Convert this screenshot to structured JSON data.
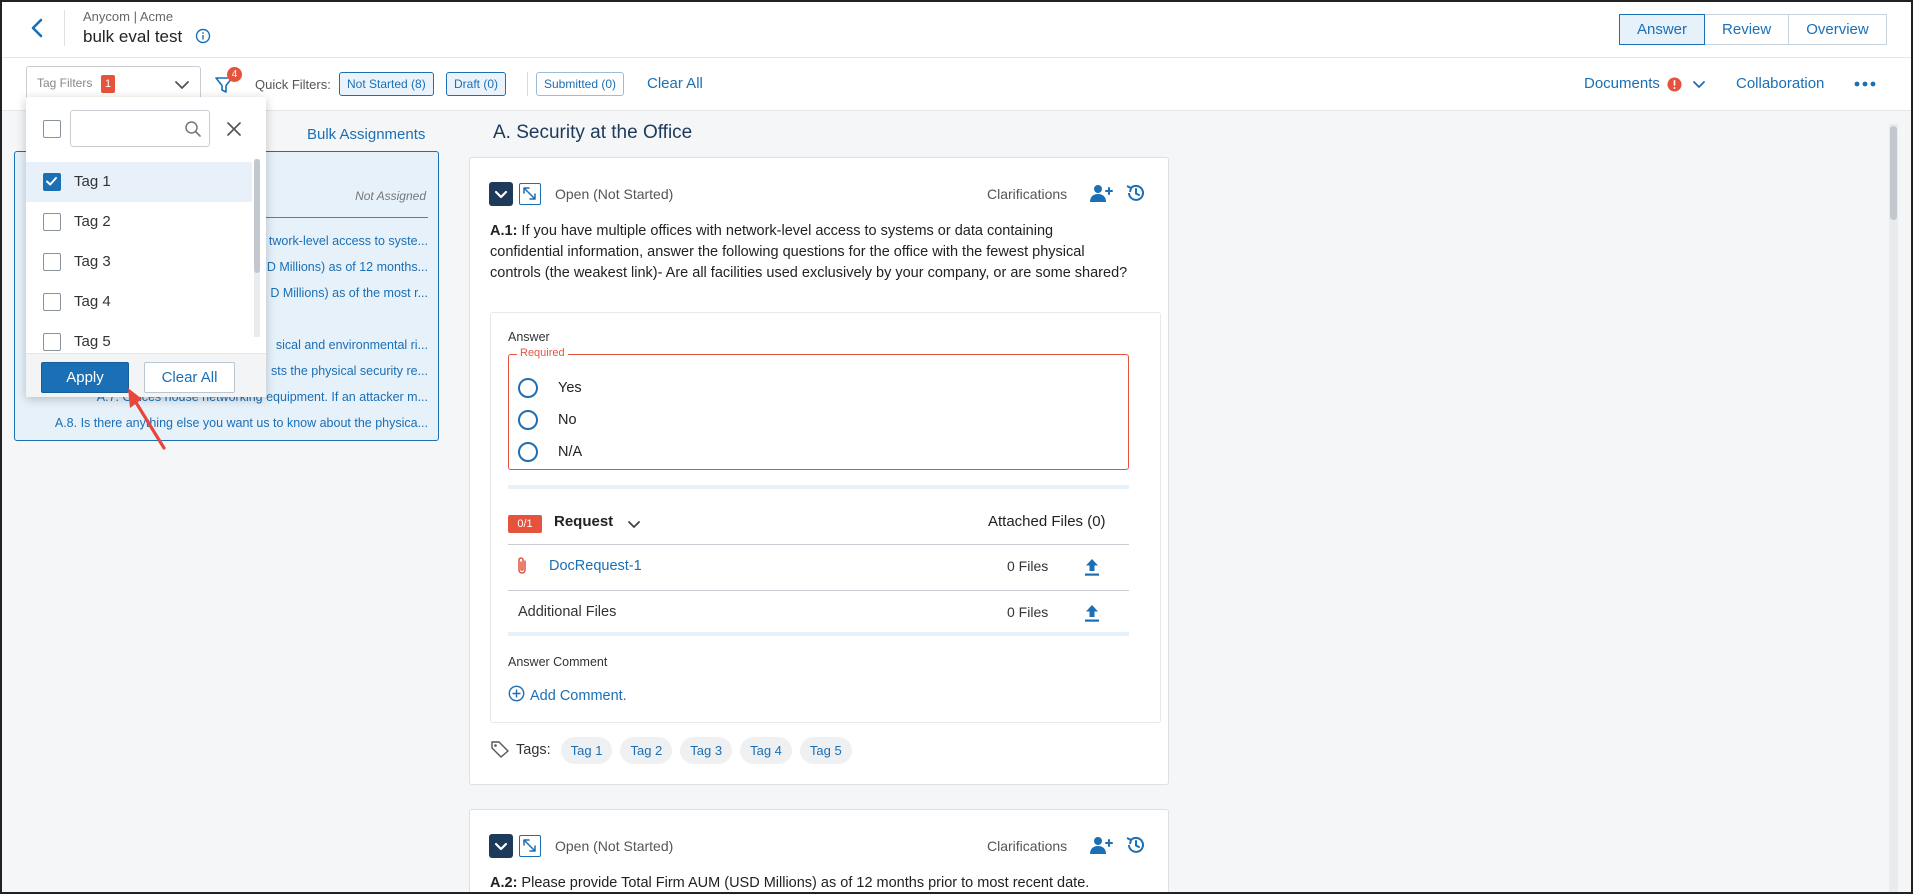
{
  "header": {
    "breadcrumb": "Anycom | Acme",
    "title": "bulk eval test",
    "tabs": [
      {
        "label": "Answer",
        "active": true
      },
      {
        "label": "Review",
        "active": false
      },
      {
        "label": "Overview",
        "active": false
      }
    ]
  },
  "filterbar": {
    "tag_filters_placeholder": "Tag Filters",
    "tag_filters_count": "1",
    "filter_badge": "4",
    "quick_filters_label": "Quick Filters:",
    "chips": [
      "Not Started (8)",
      "Draft (0)",
      "Submitted (0)"
    ],
    "clear_all": "Clear All",
    "documents": "Documents",
    "collaboration": "Collaboration"
  },
  "dropdown": {
    "search_value": "",
    "items": [
      {
        "label": "Tag 1",
        "checked": true
      },
      {
        "label": "Tag 2",
        "checked": false
      },
      {
        "label": "Tag 3",
        "checked": false
      },
      {
        "label": "Tag 4",
        "checked": false
      },
      {
        "label": "Tag 5",
        "checked": false
      }
    ],
    "apply": "Apply",
    "clear_all": "Clear All"
  },
  "left_panel": {
    "bulk_assignments": "Bulk Assignments",
    "not_assigned": "Not Assigned",
    "items": [
      "twork-level access to syste...",
      "D Millions) as of 12 months...",
      "D Millions) as of the most r...",
      "sical and environmental ri...",
      "sts the physical security re...",
      "A.7. Offices house networking equipment. If an attacker m...",
      "A.8. Is there anything else you want us to know about the physica..."
    ]
  },
  "main": {
    "section_title": "A. Security at the Office",
    "questions": [
      {
        "status": "Open (Not Started)",
        "clarifications": "Clarifications",
        "number": "A.1:",
        "text": " If you have multiple offices with network-level access to systems or data containing confidential information, answer the following questions for the office with the fewest physical controls (the weakest link)- Are all facilities used exclusively by your company, or are some shared?",
        "answer_label": "Answer",
        "required_label": "Required",
        "options": [
          "Yes",
          "No",
          "N/A"
        ],
        "request_badge": "0/1",
        "request_title": "Request",
        "attached_files": "Attached Files (0)",
        "doc_request": "DocRequest-1",
        "doc_files": "0 Files",
        "additional_files": "Additional Files",
        "additional_count": "0 Files",
        "comment_label": "Answer Comment",
        "add_comment": "Add Comment.",
        "tags_label": "Tags:",
        "tags": [
          "Tag 1",
          "Tag 2",
          "Tag 3",
          "Tag 4",
          "Tag 5"
        ]
      },
      {
        "status": "Open (Not Started)",
        "clarifications": "Clarifications",
        "number": "A.2:",
        "text": " Please provide Total Firm AUM (USD Millions) as of 12 months prior to most recent date."
      }
    ]
  },
  "colors": {
    "accent": "#1b6fb5",
    "alert": "#e5533d",
    "navy": "#1d3a5a"
  }
}
